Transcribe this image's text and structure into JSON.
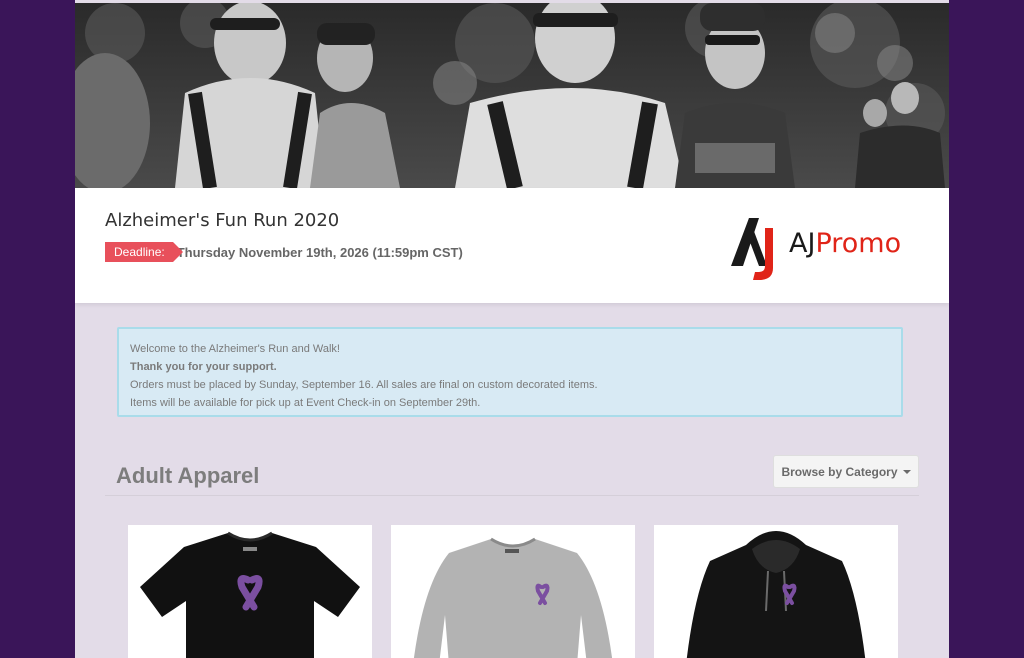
{
  "event": {
    "title": "Alzheimer's Fun Run 2020",
    "deadline_label": "Deadline:",
    "deadline_value": "Thursday November 19th, 2026 (11:59pm CST)"
  },
  "logo": {
    "text_aj": "AJ",
    "text_promo": "Promo"
  },
  "notice": {
    "line1": "Welcome to the Alzheimer's Run and Walk!",
    "line2": "Thank you for your support.",
    "line3": "Orders must be placed by Sunday, September 16. All sales are final on custom decorated items.",
    "line4": "Items will be available for pick up at Event Check-in on September 29th."
  },
  "section": {
    "title": "Adult Apparel",
    "browse_label": "Browse by Category"
  },
  "products": [
    {
      "icon": "black-tshirt-image"
    },
    {
      "icon": "grey-longsleeve-image"
    },
    {
      "icon": "black-hoodie-image"
    }
  ],
  "colors": {
    "background": "#3a1559",
    "deadline_badge": "#e8505b",
    "notice_bg": "#d8eaf4",
    "ribbon": "#7b4fa0",
    "logo_red": "#e02418"
  }
}
